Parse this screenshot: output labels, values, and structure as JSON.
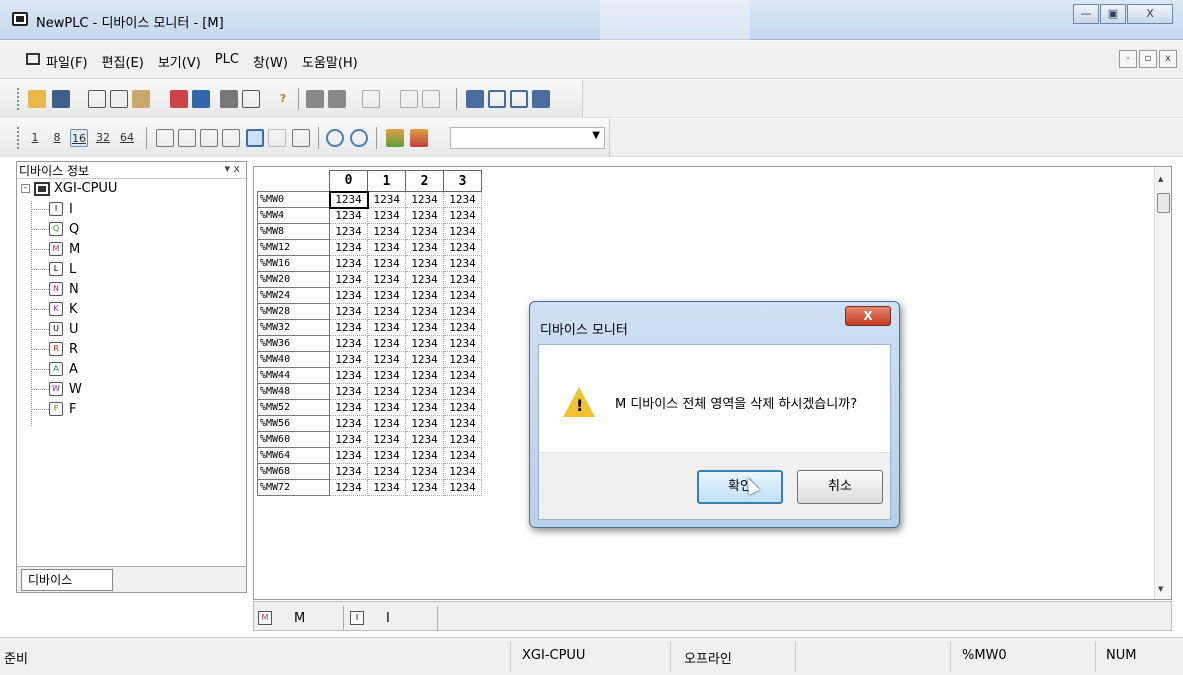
{
  "window": {
    "title": "NewPLC - 디바이스 모니터 - [M]",
    "buttons": [
      "—",
      "▣",
      "X"
    ]
  },
  "menu": {
    "items": [
      "파일(F)",
      "편집(E)",
      "보기(V)",
      "PLC",
      "창(W)",
      "도움말(H)"
    ],
    "mdi_buttons": [
      "-",
      "▫",
      "x"
    ]
  },
  "toolbar2": {
    "width_buttons": [
      "1",
      "8",
      "16",
      "32",
      "64"
    ],
    "combo_value": ""
  },
  "left_panel": {
    "title": "디바이스 정보",
    "pin": "▾ x",
    "root": "XGI-CPUU",
    "nodes": [
      {
        "icon": "I",
        "label": "I"
      },
      {
        "icon": "Q",
        "label": "Q"
      },
      {
        "icon": "M",
        "label": "M"
      },
      {
        "icon": "L",
        "label": "L"
      },
      {
        "icon": "N",
        "label": "N"
      },
      {
        "icon": "K",
        "label": "K"
      },
      {
        "icon": "U",
        "label": "U"
      },
      {
        "icon": "R",
        "label": "R"
      },
      {
        "icon": "A",
        "label": "A"
      },
      {
        "icon": "W",
        "label": "W"
      },
      {
        "icon": "F",
        "label": "F"
      }
    ],
    "tab_label": "디바이스"
  },
  "grid": {
    "columns": [
      "0",
      "1",
      "2",
      "3"
    ],
    "rows": [
      {
        "addr": "%MW0",
        "values": [
          "1234",
          "1234",
          "1234",
          "1234"
        ]
      },
      {
        "addr": "%MW4",
        "values": [
          "1234",
          "1234",
          "1234",
          "1234"
        ]
      },
      {
        "addr": "%MW8",
        "values": [
          "1234",
          "1234",
          "1234",
          "1234"
        ]
      },
      {
        "addr": "%MW12",
        "values": [
          "1234",
          "1234",
          "1234",
          "1234"
        ]
      },
      {
        "addr": "%MW16",
        "values": [
          "1234",
          "1234",
          "1234",
          "1234"
        ]
      },
      {
        "addr": "%MW20",
        "values": [
          "1234",
          "1234",
          "1234",
          "1234"
        ]
      },
      {
        "addr": "%MW24",
        "values": [
          "1234",
          "1234",
          "1234",
          "1234"
        ]
      },
      {
        "addr": "%MW28",
        "values": [
          "1234",
          "1234",
          "1234",
          "1234"
        ]
      },
      {
        "addr": "%MW32",
        "values": [
          "1234",
          "1234",
          "1234",
          "1234"
        ]
      },
      {
        "addr": "%MW36",
        "values": [
          "1234",
          "1234",
          "1234",
          "1234"
        ]
      },
      {
        "addr": "%MW40",
        "values": [
          "1234",
          "1234",
          "1234",
          "1234"
        ]
      },
      {
        "addr": "%MW44",
        "values": [
          "1234",
          "1234",
          "1234",
          "1234"
        ]
      },
      {
        "addr": "%MW48",
        "values": [
          "1234",
          "1234",
          "1234",
          "1234"
        ]
      },
      {
        "addr": "%MW52",
        "values": [
          "1234",
          "1234",
          "1234",
          "1234"
        ]
      },
      {
        "addr": "%MW56",
        "values": [
          "1234",
          "1234",
          "1234",
          "1234"
        ]
      },
      {
        "addr": "%MW60",
        "values": [
          "1234",
          "1234",
          "1234",
          "1234"
        ]
      },
      {
        "addr": "%MW64",
        "values": [
          "1234",
          "1234",
          "1234",
          "1234"
        ]
      },
      {
        "addr": "%MW68",
        "values": [
          "1234",
          "1234",
          "1234",
          "1234"
        ]
      },
      {
        "addr": "%MW72",
        "values": [
          "1234",
          "1234",
          "1234",
          "1234"
        ]
      }
    ]
  },
  "bottom_tabs": [
    {
      "icon": "M",
      "label": "M"
    },
    {
      "icon": "I",
      "label": "I"
    }
  ],
  "status": {
    "ready": "준비",
    "cpu": "XGI-CPUU",
    "mode": "오프라인",
    "address": "%MW0",
    "num": "NUM"
  },
  "dialog": {
    "title": "디바이스 모니터",
    "close_label": "X",
    "message": "M 디바이스 전체 영역을 삭제 하시겠습니까?",
    "ok_label": "확인",
    "cancel_label": "취소"
  }
}
